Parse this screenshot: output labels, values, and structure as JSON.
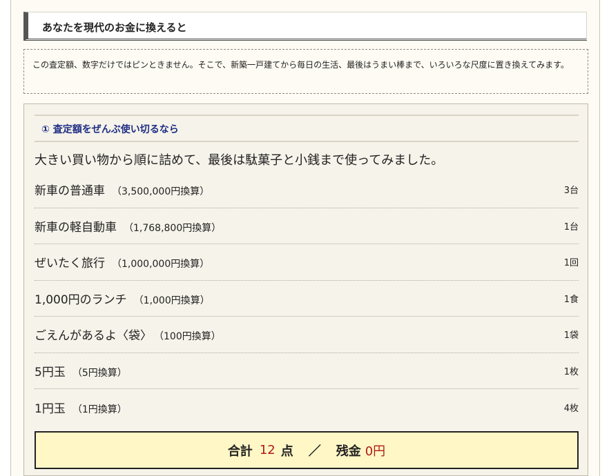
{
  "heading": "あなたを現代のお金に換えると",
  "intro": "この査定額、数字だけではピンときません。そこで、新築一戸建てから毎日の生活、最後はうまい棒まで、いろいろな尺度に置き換えてみます。",
  "panel": {
    "subheading": "① 査定額をぜんぶ使い切るなら",
    "lead": "大きい買い物から順に詰めて、最後は駄菓子と小銭まで使ってみました。",
    "items": [
      {
        "name": "新車の普通車",
        "note": "（3,500,000円換算）",
        "qty": "3台"
      },
      {
        "name": "新車の軽自動車",
        "note": "（1,768,800円換算）",
        "qty": "1台"
      },
      {
        "name": "ぜいたく旅行",
        "note": "（1,000,000円換算）",
        "qty": "1回"
      },
      {
        "name": "1,000円のランチ",
        "note": "（1,000円換算）",
        "qty": "1食"
      },
      {
        "name": "ごえんがあるよ〈袋〉",
        "note": "（100円換算）",
        "qty": "1袋"
      },
      {
        "name": "5円玉",
        "note": "（5円換算）",
        "qty": "1枚"
      },
      {
        "name": "1円玉",
        "note": "（1円換算）",
        "qty": "4枚"
      }
    ],
    "total": {
      "label_total": "合計",
      "count": "12",
      "unit": "点",
      "separator": "／",
      "label_remaining": "残金",
      "remaining": "0円"
    }
  },
  "colors": {
    "heading_bar": "#555555",
    "subheading_text": "#1e2d84",
    "total_bg": "#fff7c6",
    "accent": "#b01a1a"
  }
}
